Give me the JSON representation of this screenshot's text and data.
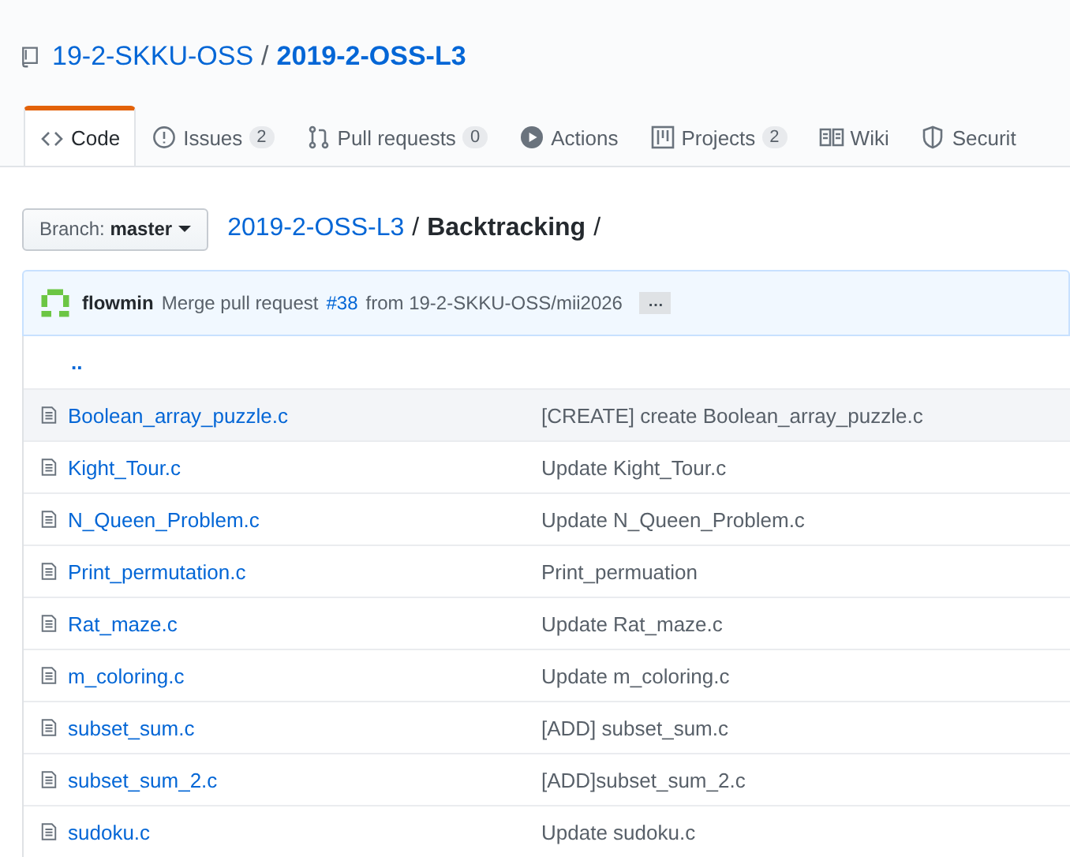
{
  "repo": {
    "owner": "19-2-SKKU-OSS",
    "separator": "/",
    "name": "2019-2-OSS-L3"
  },
  "tabs": [
    {
      "kind": "code",
      "label": "Code",
      "selected": true
    },
    {
      "kind": "issues",
      "label": "Issues",
      "count": "2",
      "selected": false
    },
    {
      "kind": "pulls",
      "label": "Pull requests",
      "count": "0",
      "selected": false
    },
    {
      "kind": "actions",
      "label": "Actions",
      "selected": false
    },
    {
      "kind": "projects",
      "label": "Projects",
      "count": "2",
      "selected": false
    },
    {
      "kind": "wiki",
      "label": "Wiki",
      "selected": false
    },
    {
      "kind": "security",
      "label": "Securit",
      "selected": false
    }
  ],
  "branch": {
    "label": "Branch:",
    "value": "master"
  },
  "path": {
    "root": "2019-2-OSS-L3",
    "separator": "/",
    "folder": "Backtracking",
    "trailing_separator": "/"
  },
  "commit": {
    "author": "flowmin",
    "message_before": "Merge pull request",
    "link": "#38",
    "message_after": "from 19-2-SKKU-OSS/mii2026",
    "more": "…"
  },
  "parent_link": "..",
  "files": [
    {
      "name": "Boolean_array_puzzle.c",
      "message": "[CREATE] create Boolean_array_puzzle.c",
      "highlighted": true
    },
    {
      "name": "Kight_Tour.c",
      "message": "Update Kight_Tour.c",
      "highlighted": false
    },
    {
      "name": "N_Queen_Problem.c",
      "message": "Update N_Queen_Problem.c",
      "highlighted": false
    },
    {
      "name": "Print_permutation.c",
      "message": "Print_permuation",
      "highlighted": false
    },
    {
      "name": "Rat_maze.c",
      "message": "Update Rat_maze.c",
      "highlighted": false
    },
    {
      "name": "m_coloring.c",
      "message": "Update m_coloring.c",
      "highlighted": false
    },
    {
      "name": "subset_sum.c",
      "message": "[ADD] subset_sum.c",
      "highlighted": false
    },
    {
      "name": "subset_sum_2.c",
      "message": "[ADD]subset_sum_2.c",
      "highlighted": false
    },
    {
      "name": "sudoku.c",
      "message": "Update sudoku.c",
      "highlighted": false
    }
  ]
}
